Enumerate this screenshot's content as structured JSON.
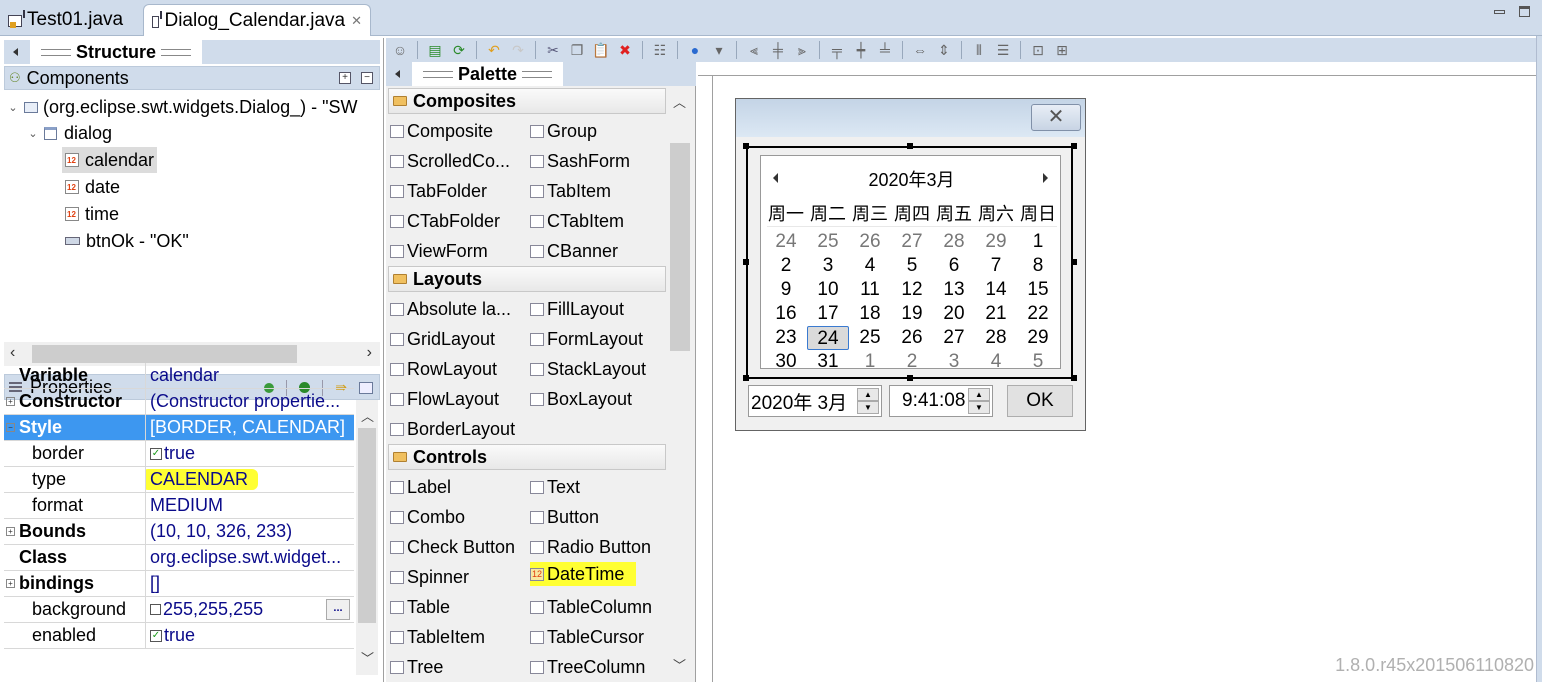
{
  "editor_tabs": [
    {
      "label": "Test01.java",
      "active": false
    },
    {
      "label": "Dialog_Calendar.java",
      "active": true,
      "close": "✕"
    }
  ],
  "structure": {
    "view_title": "Structure",
    "components_title": "Components",
    "tree": [
      {
        "label": "(org.eclipse.swt.widgets.Dialog_) - \"SW",
        "icon": "shell-icon",
        "level": 0
      },
      {
        "label": "dialog",
        "icon": "dialog-icon",
        "level": 1
      },
      {
        "label": "calendar",
        "icon": "datetime-icon",
        "level": 2,
        "selected": true
      },
      {
        "label": "date",
        "icon": "datetime-icon",
        "level": 2
      },
      {
        "label": "time",
        "icon": "datetime-icon",
        "level": 2
      },
      {
        "label": "btnOk - \"OK\"",
        "icon": "button-icon",
        "level": 2
      }
    ]
  },
  "properties": {
    "title": "Properties",
    "rows": [
      {
        "name": "Variable",
        "value": "calendar",
        "bold": true
      },
      {
        "name": "Constructor",
        "value": "(Constructor propertie...",
        "bold": true,
        "expand": "+"
      },
      {
        "name": "Style",
        "value": "[BORDER, CALENDAR]",
        "bold": true,
        "expand": "-",
        "selected": true
      },
      {
        "name": "border",
        "value": "true",
        "checkbox": true
      },
      {
        "name": "type",
        "value": "CALENDAR",
        "highlight": true
      },
      {
        "name": "format",
        "value": "MEDIUM"
      },
      {
        "name": "Bounds",
        "value": "(10, 10, 326, 233)",
        "bold": true,
        "expand": "+"
      },
      {
        "name": "Class",
        "value": "org.eclipse.swt.widget...",
        "bold": true
      },
      {
        "name": "bindings",
        "value": "[]",
        "bold": true,
        "expand": "+"
      },
      {
        "name": "background",
        "value": "255,255,255",
        "color_swatch": "#ffffff",
        "button": "..."
      },
      {
        "name": "enabled",
        "value": "true",
        "checkbox": true
      }
    ]
  },
  "palette": {
    "title": "Palette",
    "categories": [
      {
        "name": "Composites",
        "items": [
          "Composite",
          "Group",
          "ScrolledCo...",
          "SashForm",
          "TabFolder",
          "TabItem",
          "CTabFolder",
          "CTabItem",
          "ViewForm",
          "CBanner"
        ]
      },
      {
        "name": "Layouts",
        "items": [
          "Absolute la...",
          "FillLayout",
          "GridLayout",
          "FormLayout",
          "RowLayout",
          "StackLayout",
          "FlowLayout",
          "BoxLayout",
          "BorderLayout"
        ]
      },
      {
        "name": "Controls",
        "items": [
          "Label",
          "Text",
          "Combo",
          "Button",
          "Check Button",
          "Radio Button",
          "Spinner",
          "DateTime",
          "Table",
          "TableColumn",
          "TableItem",
          "TableCursor",
          "Tree",
          "TreeColumn"
        ]
      }
    ],
    "highlighted_item": "DateTime"
  },
  "toolbar": [
    "test-ui-icon",
    "source-icon",
    "refresh-icon",
    "undo-icon",
    "redo-icon",
    "cut-icon",
    "copy-icon",
    "paste-icon",
    "delete-icon",
    "properties-icon",
    "locale-icon",
    "dropdown-icon",
    "align-left-icon",
    "align-center-icon",
    "align-right-icon",
    "align-top-icon",
    "align-middle-icon",
    "align-bottom-icon",
    "same-width-icon",
    "same-height-icon",
    "space-horiz-icon",
    "space-vert-icon",
    "center-horiz-icon",
    "center-vert-icon"
  ],
  "dialog": {
    "close_glyph": "✕",
    "calendar": {
      "month_title": "2020年3月",
      "weekdays": [
        "周一",
        "周二",
        "周三",
        "周四",
        "周五",
        "周六",
        "周日"
      ],
      "weeks": [
        [
          "24",
          "25",
          "26",
          "27",
          "28",
          "29",
          "1"
        ],
        [
          "2",
          "3",
          "4",
          "5",
          "6",
          "7",
          "8"
        ],
        [
          "9",
          "10",
          "11",
          "12",
          "13",
          "14",
          "15"
        ],
        [
          "16",
          "17",
          "18",
          "19",
          "20",
          "21",
          "22"
        ],
        [
          "23",
          "24",
          "25",
          "26",
          "27",
          "28",
          "29"
        ],
        [
          "30",
          "31",
          "1",
          "2",
          "3",
          "4",
          "5"
        ]
      ],
      "selected_day": "24"
    },
    "date_value": "2020年  3月",
    "time_value": "9:41:08",
    "ok_label": "OK"
  },
  "version": "1.8.0.r45x201506110820"
}
